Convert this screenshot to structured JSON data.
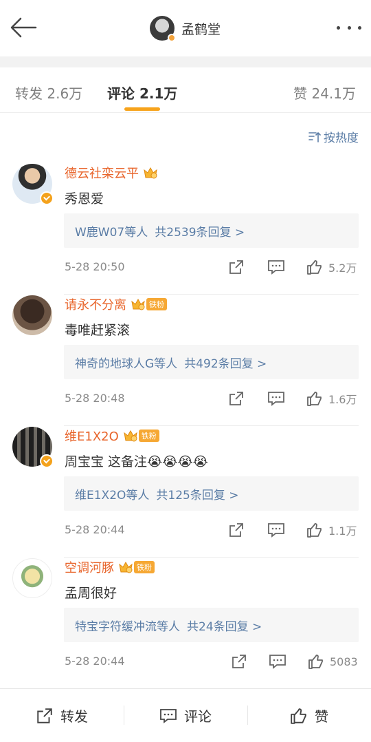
{
  "header": {
    "title": "孟鹤堂",
    "back_icon": "back-arrow-icon",
    "more_icon": "more-dots-icon"
  },
  "tabs": {
    "forward": "转发 2.6万",
    "comment": "评论 2.1万",
    "like": "赞 24.1万",
    "accent": "#f7a31b"
  },
  "sort": {
    "label": "按热度",
    "icon": "sort-icon"
  },
  "comments": [
    {
      "user": "德云社栾云平",
      "fan_tag": "",
      "text": "秀恩爱",
      "reply_users": "W鹿W07等人",
      "reply_count": "共2539条回复 >",
      "time": "5-28 20:50",
      "likes": "5.2万"
    },
    {
      "user": "请永不分离",
      "fan_tag": "铁粉",
      "text": "毒唯赶紧滚",
      "reply_users": "神奇的地球人G等人",
      "reply_count": "共492条回复 >",
      "time": "5-28 20:48",
      "likes": "1.6万"
    },
    {
      "user": "维E1X2O",
      "fan_tag": "铁粉",
      "text": "周宝宝 这备注😭😭😭😭",
      "reply_users": "维E1X2O等人",
      "reply_count": "共125条回复 >",
      "time": "5-28 20:44",
      "likes": "1.1万"
    },
    {
      "user": "空调河豚",
      "fan_tag": "铁粉",
      "text": "孟周很好",
      "reply_users": "特宝字符缓冲流等人",
      "reply_count": "共24条回复 >",
      "time": "5-28 20:44",
      "likes": "5083"
    }
  ],
  "bottom": {
    "forward": "转发",
    "comment": "评论",
    "like": "赞"
  },
  "colors": {
    "username": "#e8642a",
    "link": "#5b7da6",
    "fan_tag": "#f6a834"
  }
}
